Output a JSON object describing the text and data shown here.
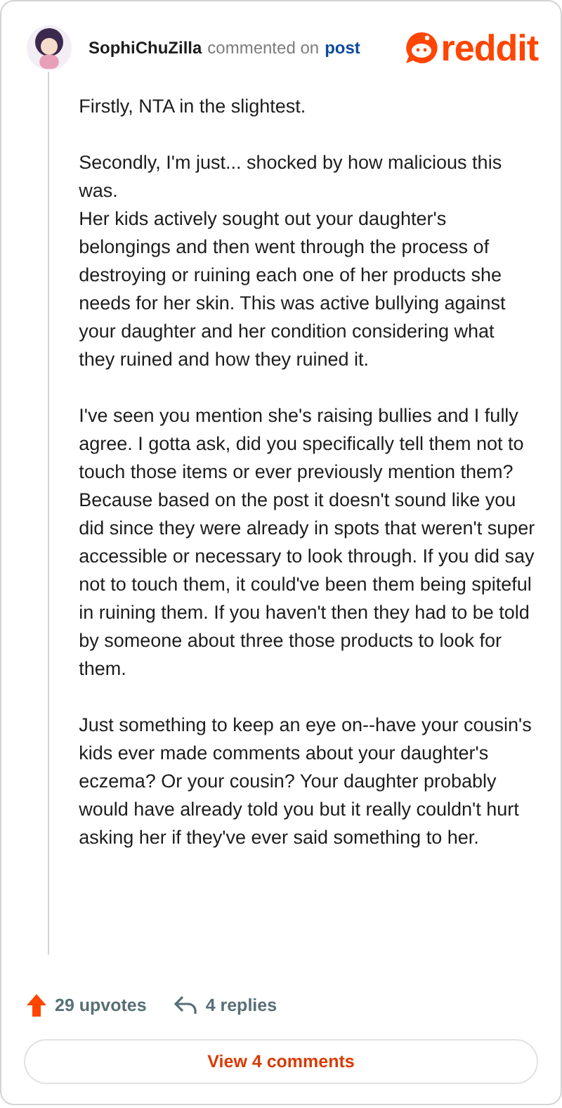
{
  "comment": {
    "author": "SophiChuZilla",
    "action": "commented on",
    "link": "post",
    "logo_text": "reddit",
    "paragraphs": [
      "Firstly, NTA in the slightest.",
      "Secondly, I'm just... shocked by how malicious this was.\nHer kids actively sought out your daughter's belongings and then went through the process of destroying or ruining each one of her products she needs for her skin. This was active bullying against your daughter and her condition considering what they ruined and how they ruined it.",
      "I've seen you mention she's raising bullies and I fully agree. I gotta ask, did you specifically tell them not to touch those items or ever previously mention them? Because based on the post it doesn't sound like you did since they were already in spots that weren't super accessible or necessary to look through. If you did say not to touch them, it could've been them being spiteful in ruining them. If you haven't then they had to be told by someone about three those products to look for them.",
      "Just something to keep an eye on--have your cousin's kids ever made comments about your daughter's eczema? Or your cousin? Your daughter probably would have already told you but it really couldn't hurt asking her if they've ever said something to her."
    ]
  },
  "footer": {
    "upvotes": "29 upvotes",
    "replies": "4 replies",
    "view_button": "View 4 comments"
  }
}
